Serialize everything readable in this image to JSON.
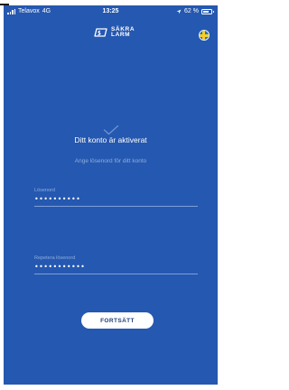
{
  "status_bar": {
    "carrier": "Telavox",
    "network": "4G",
    "time": "13:25",
    "battery": "62 %"
  },
  "header": {
    "logo_line1": "SÄKRA",
    "logo_line2": "LARM",
    "language_icon": "swedish-flag-icon"
  },
  "main": {
    "check_icon": "checkmark-icon",
    "title": "Ditt konto är aktiverat",
    "subtitle": "Ange lösenord för ditt konto",
    "password": {
      "label": "Lösenord",
      "value": "••••••••••"
    },
    "repeat_password": {
      "label": "Repetera lösenord",
      "value": "•••••••••••"
    },
    "continue_label": "FORTSÄTT"
  },
  "colors": {
    "background": "#2558b0",
    "text": "#ffffff",
    "muted": "#8eaee0",
    "button_text": "#1a3f7c"
  }
}
